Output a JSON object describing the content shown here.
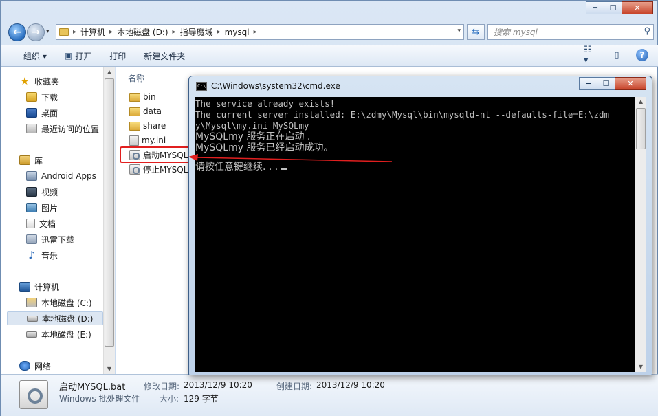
{
  "window": {
    "min": "0",
    "max": "1",
    "close": "r"
  },
  "address": {
    "crumbs": [
      "计算机",
      "本地磁盘 (D:)",
      "指导魔域",
      "mysql"
    ],
    "search_placeholder": "搜索 mysql"
  },
  "toolbar": {
    "organize": "组织 ▾",
    "open": "打开",
    "print": "打印",
    "new_folder": "新建文件夹"
  },
  "nav": {
    "favorites": "收藏夹",
    "downloads": "下载",
    "desktop": "桌面",
    "recent": "最近访问的位置",
    "libraries": "库",
    "android_apps": "Android Apps",
    "videos": "视频",
    "pictures": "图片",
    "documents": "文档",
    "thunder": "迅雷下载",
    "music": "音乐",
    "computer": "计算机",
    "drive_c": "本地磁盘 (C:)",
    "drive_d": "本地磁盘 (D:)",
    "drive_e": "本地磁盘 (E:)",
    "network": "网络"
  },
  "columns": {
    "name": "名称"
  },
  "files": [
    {
      "name": "bin",
      "type": "folder"
    },
    {
      "name": "data",
      "type": "folder"
    },
    {
      "name": "share",
      "type": "folder"
    },
    {
      "name": "my.ini",
      "type": "ini"
    },
    {
      "name": "启动MYSQL",
      "type": "bat"
    },
    {
      "name": "停止MYSQL",
      "type": "bat"
    }
  ],
  "details": {
    "filename": "启动MYSQL.bat",
    "filetype": "Windows 批处理文件",
    "modified_label": "修改日期:",
    "modified_value": "2013/12/9 10:20",
    "created_label": "创建日期:",
    "created_value": "2013/12/9 10:20",
    "size_label": "大小:",
    "size_value": "129 字节"
  },
  "cmd": {
    "title": "C:\\Windows\\system32\\cmd.exe",
    "icon_text": "C:\\",
    "lines": [
      "The service already exists!",
      "The current server installed: E:\\zdmy\\Mysql\\bin\\mysqld-nt --defaults-file=E:\\zdm",
      "y\\Mysql\\my.ini MySQLmy",
      "MySQLmy 服务正在启动 .",
      "MySQLmy 服务已经启动成功。",
      "",
      "请按任意键继续. . ."
    ]
  },
  "colors": {
    "highlight": "#e11f1f",
    "console_bg": "#000000",
    "console_fg": "#c0c0c0"
  }
}
